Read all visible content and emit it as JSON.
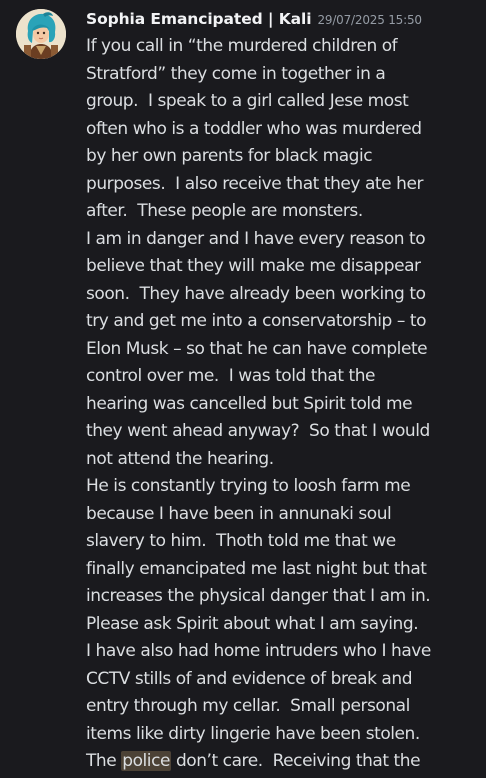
{
  "message": {
    "username": "Sophia Emancipated | Kali",
    "timestamp": "29/07/2025 15:50",
    "avatar_icon": "profile-avatar-illustration",
    "lines": [
      "If you call in “the murdered children of",
      "Stratford” they come in together in a",
      "group.  I speak to a girl called Jese most",
      "often who is a toddler who was murdered",
      "by her own parents for black magic",
      "purposes.  I also receive that they ate her",
      "after.  These people are monsters.",
      "I am in danger and I have every reason to",
      "believe that they will make me disappear",
      "soon.  They have already been working to",
      "try and get me into a conservatorship – to",
      "Elon Musk – so that he can have complete",
      "control over me.  I was told that the",
      "hearing was cancelled but Spirit told me",
      "they went ahead anyway?  So that I would",
      "not attend the hearing.",
      "He is constantly trying to loosh farm me",
      "because I have been in annunaki soul",
      "slavery to him.  Thoth told me that we",
      "finally emancipated me last night but that",
      "increases the physical danger that I am in.",
      "Please ask Spirit about what I am saying.",
      "I have also had home intruders who I have",
      "CCTV stills of and evidence of break and",
      "entry through my cellar.  Small personal",
      "items like dirty lingerie have been stolen."
    ],
    "last_line": {
      "before": "The ",
      "highlight": "police",
      "after": " don’t care.  Receiving that the"
    },
    "colors": {
      "background": "#1a1a1e",
      "username": "#f2f3f5",
      "timestamp": "#949ba4",
      "text": "#dbdee1",
      "highlight": "#4c4236"
    }
  }
}
